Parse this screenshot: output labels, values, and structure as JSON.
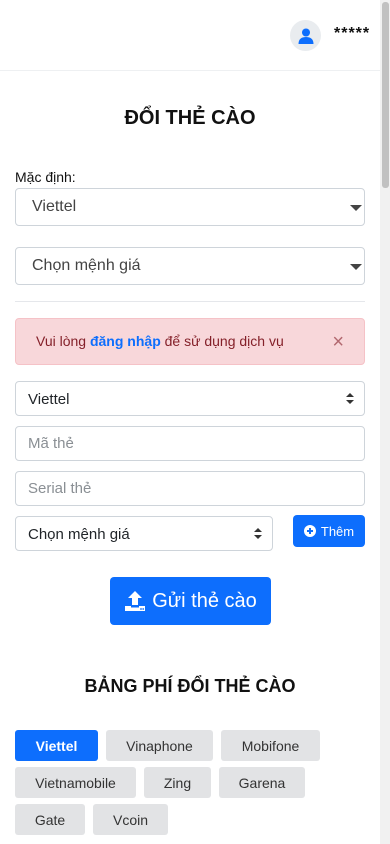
{
  "header": {
    "username": "*****",
    "avatar_icon": "user-icon"
  },
  "main": {
    "title": "ĐỔI THẺ CÀO",
    "default_label": "Mặc định:",
    "default_select_value": "Viettel",
    "default_amount_select_value": "Chọn mệnh giá",
    "alert": {
      "text_before": "Vui lòng ",
      "link_text": "đăng nhập",
      "text_after": " để sử dụng dịch vụ",
      "close_symbol": "×"
    },
    "card_form": {
      "telco_value": "Viettel",
      "code_placeholder": "Mã thẻ",
      "serial_placeholder": "Serial thẻ",
      "amount_value": "Chọn mệnh giá",
      "add_label": "Thêm"
    },
    "submit_label": "Gửi thẻ cào"
  },
  "fees": {
    "title": "BẢNG PHÍ ĐỔI THẺ CÀO",
    "tabs": [
      {
        "label": "Viettel",
        "active": true
      },
      {
        "label": "Vinaphone",
        "active": false
      },
      {
        "label": "Mobifone",
        "active": false
      },
      {
        "label": "Vietnamobile",
        "active": false
      },
      {
        "label": "Zing",
        "active": false
      },
      {
        "label": "Garena",
        "active": false
      },
      {
        "label": "Gate",
        "active": false
      },
      {
        "label": "Vcoin",
        "active": false
      }
    ]
  },
  "colors": {
    "primary": "#0d6efd",
    "alert_bg": "#f8d7da",
    "alert_text": "#842029",
    "tab_bg": "#e2e3e5"
  }
}
